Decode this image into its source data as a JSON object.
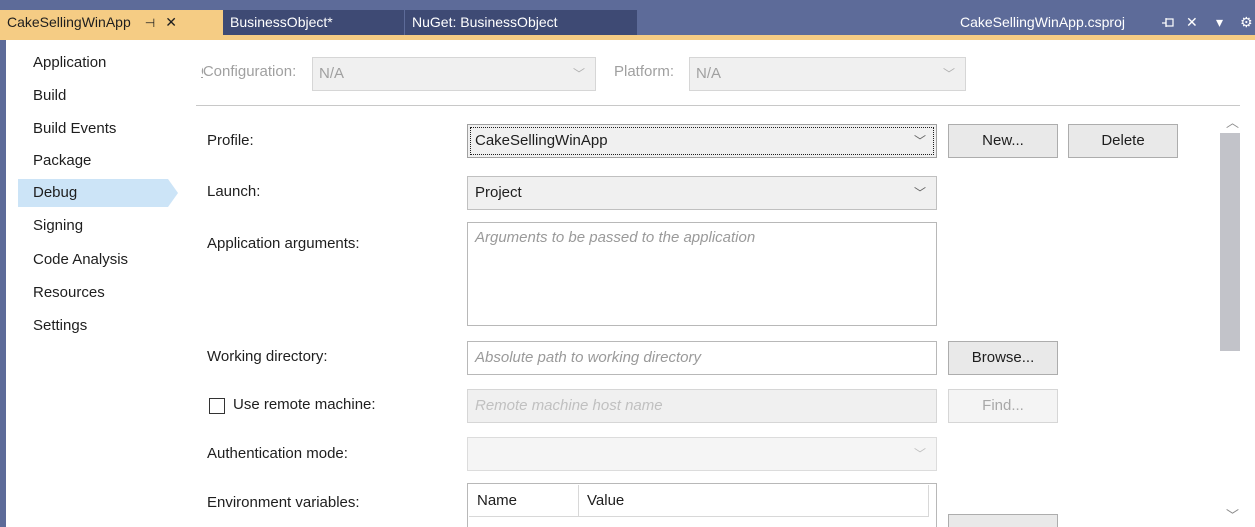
{
  "tabs": [
    {
      "label": "CakeSellingWinApp",
      "pin": "⊣",
      "close": "✕",
      "state": "active"
    },
    {
      "label": "BusinessObject*",
      "state": "inactive"
    },
    {
      "label": "NuGet: BusinessObject",
      "state": "inactive"
    }
  ],
  "right_tab": {
    "label": "CakeSellingWinApp.csproj",
    "pin_icon": "pin-icon",
    "close": "✕",
    "dropdown": "▾",
    "settings": "⚙"
  },
  "sidebar": {
    "items": [
      {
        "label": "Application"
      },
      {
        "label": "Build"
      },
      {
        "label": "Build Events"
      },
      {
        "label": "Package"
      },
      {
        "label": "Debug",
        "selected": true
      },
      {
        "label": "Signing"
      },
      {
        "label": "Code Analysis"
      },
      {
        "label": "Resources"
      },
      {
        "label": "Settings"
      }
    ]
  },
  "config": {
    "configuration_label": "Configuration:",
    "configuration_value": "N/A",
    "platform_label": "Platform:",
    "platform_value": "N/A"
  },
  "form": {
    "profile_label": "Profile:",
    "profile_value": "CakeSellingWinApp",
    "new_button": "New...",
    "delete_button": "Delete",
    "launch_label": "Launch:",
    "launch_value": "Project",
    "app_args_label": "Application arguments:",
    "app_args_placeholder": "Arguments to be passed to the application",
    "working_dir_label": "Working directory:",
    "working_dir_placeholder": "Absolute path to working directory",
    "browse_button": "Browse...",
    "remote_label": "Use remote machine:",
    "remote_checked": false,
    "remote_placeholder": "Remote machine host name",
    "find_button": "Find...",
    "auth_label": "Authentication mode:",
    "auth_value": "",
    "env_label": "Environment variables:",
    "env_columns": [
      "Name",
      "Value"
    ]
  },
  "colors": {
    "tabbar": "#5d6b99",
    "active_tab": "#f5cc84",
    "selected_sidebar": "#cce4f7"
  }
}
